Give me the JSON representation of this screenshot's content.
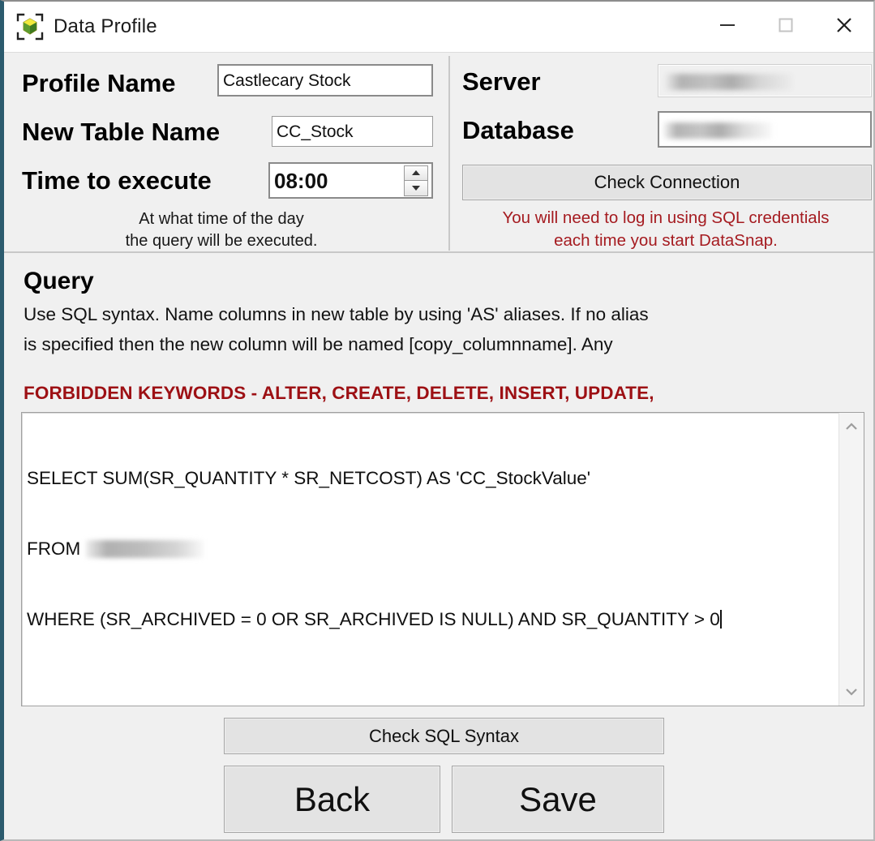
{
  "window": {
    "title": "Data Profile",
    "icon": "cube-brackets-icon",
    "controls": {
      "minimize": "minimize-icon",
      "maximize": "maximize-icon",
      "close": "close-icon"
    }
  },
  "colors": {
    "window_border": "#2c5b6e",
    "panel_bg": "#f0f0f0",
    "warning_red": "#a51b20",
    "forbidden_red": "#9d1014",
    "button_face": "#e3e3e3"
  },
  "profile": {
    "profile_name_label": "Profile Name",
    "profile_name_value": "Castlecary Stock",
    "new_table_name_label": "New Table Name",
    "new_table_name_value": "CC_Stock",
    "time_to_execute_label": "Time to execute",
    "time_to_execute_value": "08:00",
    "time_helper_line1": "At what time of the day",
    "time_helper_line2": "the query will be executed."
  },
  "connection": {
    "server_label": "Server",
    "server_value": "",
    "database_label": "Database",
    "database_value": "",
    "check_connection_label": "Check Connection",
    "warning_line1": "You will need to log in using SQL credentials",
    "warning_line2": "each time you start DataSnap."
  },
  "query": {
    "heading": "Query",
    "description_line1": "Use SQL syntax. Name columns in new table by using 'AS' aliases. If no alias",
    "description_line2": "is specified then the new column will be named [copy_columnname].  Any",
    "forbidden_keywords": "FORBIDDEN KEYWORDS - ALTER, CREATE, DELETE, INSERT, UPDATE,",
    "sql_line1": "SELECT SUM(SR_QUANTITY * SR_NETCOST) AS 'CC_StockValue'",
    "sql_line2_prefix": "FROM ",
    "sql_line3": "WHERE (SR_ARCHIVED = 0 OR SR_ARCHIVED IS NULL) AND SR_QUANTITY > 0"
  },
  "actions": {
    "check_sql_label": "Check SQL Syntax",
    "back_label": "Back",
    "save_label": "Save"
  }
}
